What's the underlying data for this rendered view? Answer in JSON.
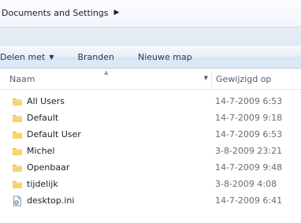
{
  "address_bar": {
    "breadcrumb": "Documents and Settings",
    "arrow_icon": "chevron-right-icon"
  },
  "toolbar": {
    "organize_label": "Delen met",
    "burn_label": "Branden",
    "new_folder_label": "Nieuwe map"
  },
  "columns": {
    "name": "Naam",
    "date_modified": "Gewijzigd op"
  },
  "files": [
    {
      "name": "All Users",
      "modified": "14-7-2009 6:53",
      "icon": "folder-icon"
    },
    {
      "name": "Default",
      "modified": "14-7-2009 9:18",
      "icon": "folder-icon"
    },
    {
      "name": "Default User",
      "modified": "14-7-2009 6:53",
      "icon": "folder-icon"
    },
    {
      "name": "Michel",
      "modified": "3-8-2009 23:21",
      "icon": "folder-icon"
    },
    {
      "name": "Openbaar",
      "modified": "14-7-2009 9:48",
      "icon": "folder-icon"
    },
    {
      "name": "tijdelijk",
      "modified": "3-8-2009 4:08",
      "icon": "folder-icon"
    },
    {
      "name": "desktop.ini",
      "modified": "14-7-2009 6:41",
      "icon": "settings-file-icon"
    }
  ],
  "colors": {
    "toolbar_text": "#1e3a5f",
    "header_text": "#4c607a",
    "folder_yellow": "#f2c94c",
    "date_text": "#6d6d6d"
  }
}
